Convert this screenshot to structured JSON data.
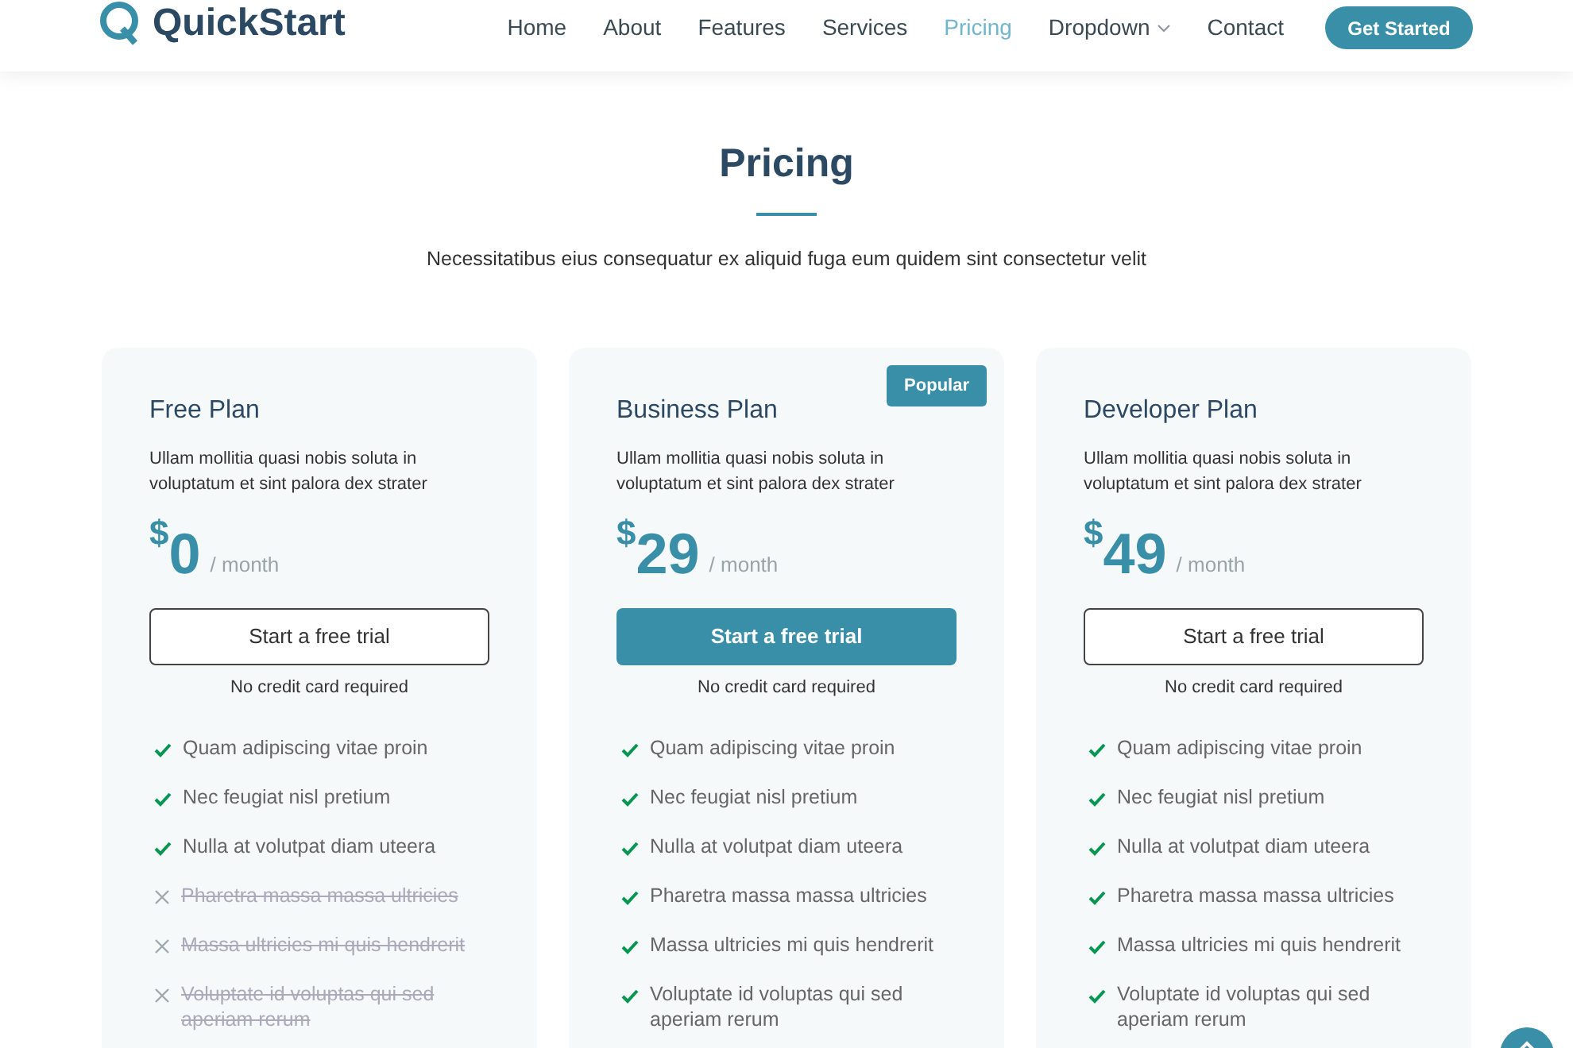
{
  "header": {
    "logo": "QuickStart",
    "nav": [
      {
        "label": "Home",
        "selected": false,
        "has_dropdown": false
      },
      {
        "label": "About",
        "selected": false,
        "has_dropdown": false
      },
      {
        "label": "Features",
        "selected": false,
        "has_dropdown": false
      },
      {
        "label": "Services",
        "selected": false,
        "has_dropdown": false
      },
      {
        "label": "Pricing",
        "selected": true,
        "has_dropdown": false
      },
      {
        "label": "Dropdown",
        "selected": false,
        "has_dropdown": true
      },
      {
        "label": "Contact",
        "selected": false,
        "has_dropdown": false
      }
    ],
    "cta": "Get Started"
  },
  "section": {
    "title": "Pricing",
    "subtitle": "Necessitatibus eius consequatur ex aliquid fuga eum quidem sint consectetur velit"
  },
  "plans": [
    {
      "name": "Free Plan",
      "description": "Ullam mollitia quasi nobis soluta in voluptatum et sint palora dex strater",
      "currency": "$",
      "price": "0",
      "period": "/ month",
      "button": "Start a free trial",
      "featured": false,
      "note": "No credit card required",
      "features": [
        {
          "text": "Quam adipiscing vitae proin",
          "included": true
        },
        {
          "text": "Nec feugiat nisl pretium",
          "included": true
        },
        {
          "text": "Nulla at volutpat diam uteera",
          "included": true
        },
        {
          "text": "Pharetra massa massa ultricies",
          "included": false
        },
        {
          "text": "Massa ultricies mi quis hendrerit",
          "included": false
        },
        {
          "text": "Voluptate id voluptas qui sed aperiam rerum",
          "included": false
        }
      ]
    },
    {
      "name": "Business Plan",
      "badge": "Popular",
      "description": "Ullam mollitia quasi nobis soluta in voluptatum et sint palora dex strater",
      "currency": "$",
      "price": "29",
      "period": "/ month",
      "button": "Start a free trial",
      "featured": true,
      "note": "No credit card required",
      "features": [
        {
          "text": "Quam adipiscing vitae proin",
          "included": true
        },
        {
          "text": "Nec feugiat nisl pretium",
          "included": true
        },
        {
          "text": "Nulla at volutpat diam uteera",
          "included": true
        },
        {
          "text": "Pharetra massa massa ultricies",
          "included": true
        },
        {
          "text": "Massa ultricies mi quis hendrerit",
          "included": true
        },
        {
          "text": "Voluptate id voluptas qui sed aperiam rerum",
          "included": true
        }
      ]
    },
    {
      "name": "Developer Plan",
      "description": "Ullam mollitia quasi nobis soluta in voluptatum et sint palora dex strater",
      "currency": "$",
      "price": "49",
      "period": "/ month",
      "button": "Start a free trial",
      "featured": false,
      "note": "No credit card required",
      "features": [
        {
          "text": "Quam adipiscing vitae proin",
          "included": true
        },
        {
          "text": "Nec feugiat nisl pretium",
          "included": true
        },
        {
          "text": "Nulla at volutpat diam uteera",
          "included": true
        },
        {
          "text": "Pharetra massa massa ultricies",
          "included": true
        },
        {
          "text": "Massa ultricies mi quis hendrerit",
          "included": true
        },
        {
          "text": "Voluptate id voluptas qui sed aperiam rerum",
          "included": true
        }
      ]
    }
  ]
}
